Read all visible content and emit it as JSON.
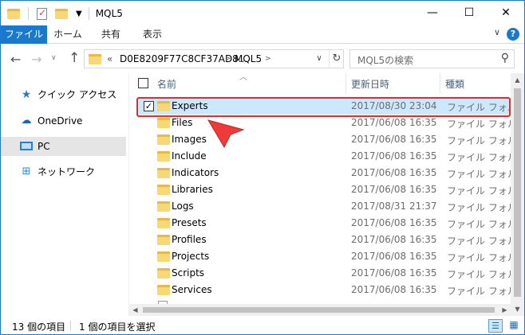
{
  "window": {
    "title": "MQL5",
    "controls": {
      "minimize": "—",
      "maximize": "☐",
      "close": "✕"
    }
  },
  "ribbon": {
    "tabs": [
      "ファイル",
      "ホーム",
      "共有",
      "表示"
    ],
    "expand_glyph": "∨",
    "help_glyph": "?"
  },
  "address": {
    "overflow": "«",
    "crumbs": [
      "D0E8209F77C8CF37AD8...",
      "MQL5"
    ],
    "separator": ">"
  },
  "search": {
    "placeholder": "MQL5の検索"
  },
  "sidebar": {
    "items": [
      {
        "label": "クイック アクセス",
        "icon": "star-icon"
      },
      {
        "label": "OneDrive",
        "icon": "cloud-icon"
      },
      {
        "label": "PC",
        "icon": "pc-icon",
        "selected": true
      },
      {
        "label": "ネットワーク",
        "icon": "network-icon"
      }
    ]
  },
  "columns": {
    "name": "名前",
    "date": "更新日時",
    "type": "種類"
  },
  "files": [
    {
      "name": "Experts",
      "date": "2017/08/30 23:04",
      "type": "ファイル フォルダー",
      "selected": true
    },
    {
      "name": "Files",
      "date": "2017/06/08 16:35",
      "type": "ファイル フォルダー"
    },
    {
      "name": "Images",
      "date": "2017/06/08 16:35",
      "type": "ファイル フォルダー"
    },
    {
      "name": "Include",
      "date": "2017/06/08 16:35",
      "type": "ファイル フォルダー"
    },
    {
      "name": "Indicators",
      "date": "2017/06/08 16:35",
      "type": "ファイル フォルダー"
    },
    {
      "name": "Libraries",
      "date": "2017/06/08 16:35",
      "type": "ファイル フォルダー"
    },
    {
      "name": "Logs",
      "date": "2017/08/31 21:37",
      "type": "ファイル フォルダー"
    },
    {
      "name": "Presets",
      "date": "2017/06/08 16:35",
      "type": "ファイル フォルダー"
    },
    {
      "name": "Profiles",
      "date": "2017/06/08 16:35",
      "type": "ファイル フォルダー"
    },
    {
      "name": "Projects",
      "date": "2017/06/08 16:35",
      "type": "ファイル フォルダー"
    },
    {
      "name": "Scripts",
      "date": "2017/06/08 16:35",
      "type": "ファイル フォルダー"
    },
    {
      "name": "Services",
      "date": "2017/06/08 16:35",
      "type": "ファイル フォルダー"
    }
  ],
  "status": {
    "item_count": "13 個の項目",
    "selected_count": "1 個の項目を選択"
  },
  "colors": {
    "accent": "#1979ca",
    "selection": "#cce8ff",
    "highlight_border": "#e62a2a",
    "folder": "#f8d775"
  }
}
